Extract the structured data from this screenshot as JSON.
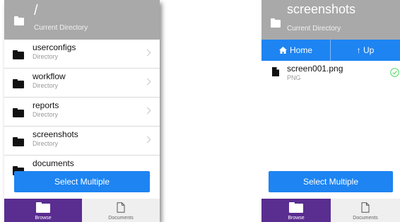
{
  "left_screen": {
    "header": {
      "title": "/",
      "subtitle": "Current Directory",
      "icon": "folder-icon"
    },
    "items": [
      {
        "name": "userconfigs",
        "type": "Directory"
      },
      {
        "name": "workflow",
        "type": "Directory"
      },
      {
        "name": "reports",
        "type": "Directory"
      },
      {
        "name": "screenshots",
        "type": "Directory"
      },
      {
        "name": "documents",
        "type": ""
      }
    ],
    "select_button": "Select Multiple",
    "tabs": [
      {
        "label": "Browse",
        "icon": "folder-icon",
        "active": true
      },
      {
        "label": "Documents",
        "icon": "document-icon",
        "active": false
      }
    ]
  },
  "right_screen": {
    "header": {
      "title": "screenshots",
      "subtitle": "Current Directory",
      "icon": "folder-icon"
    },
    "nav": {
      "home_label": "Home",
      "up_label": "↑ Up"
    },
    "files": [
      {
        "name": "screen001.png",
        "type": "PNG",
        "selected": true
      }
    ],
    "select_button": "Select Multiple",
    "tabs": [
      {
        "label": "Browse",
        "icon": "folder-icon",
        "active": true
      },
      {
        "label": "Documents",
        "icon": "document-icon",
        "active": false
      }
    ]
  },
  "colors": {
    "header_gray": "#a9a9a9",
    "accent_blue": "#1d84f2",
    "tab_purple": "#5a2d91",
    "check_green": "#4cd964"
  }
}
